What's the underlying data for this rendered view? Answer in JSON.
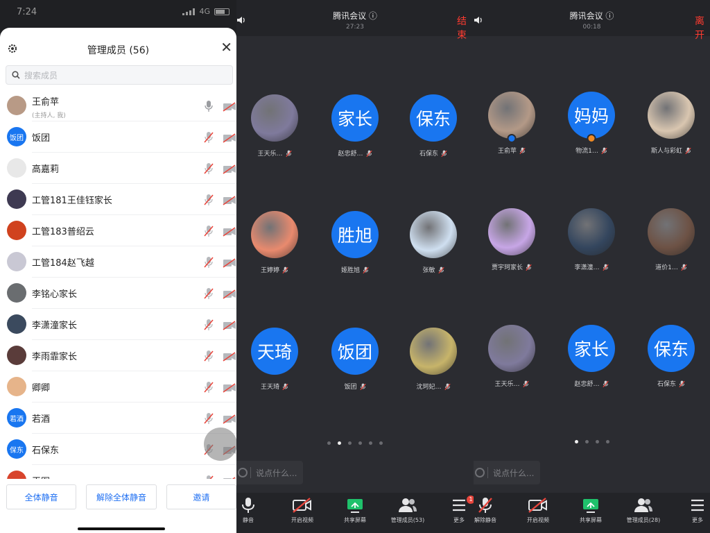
{
  "left": {
    "status": {
      "time": "7:24",
      "network": "4G"
    },
    "title": "管理成员 (56)",
    "search_placeholder": "搜索成员",
    "members": [
      {
        "name": "王俞苹",
        "sub": "(主持人, 我)",
        "avatar": "photo",
        "color": "#b89a86"
      },
      {
        "name": "饭团",
        "avatar_text": "饭团",
        "color": "#1976f0"
      },
      {
        "name": "高嘉莉",
        "avatar": "photo",
        "color": "#e8e8e8"
      },
      {
        "name": "工管181王佳钰家长",
        "avatar": "photo",
        "color": "#3e3a52"
      },
      {
        "name": "工管183普绍云",
        "avatar": "photo",
        "color": "#d0421e"
      },
      {
        "name": "工管184赵飞越",
        "avatar": "photo",
        "color": "#c9c8d4"
      },
      {
        "name": "李铭心家长",
        "avatar": "photo",
        "color": "#6a6d70"
      },
      {
        "name": "李潇潼家长",
        "avatar": "photo",
        "color": "#3b4a5e"
      },
      {
        "name": "李雨霏家长",
        "avatar": "photo",
        "color": "#5a3c3a"
      },
      {
        "name": "卿卿",
        "avatar": "photo",
        "color": "#e6b48a"
      },
      {
        "name": "若酒",
        "avatar_text": "若酒",
        "color": "#1976f0"
      },
      {
        "name": "石保东",
        "avatar_text": "保东",
        "color": "#1976f0"
      },
      {
        "name": "王图",
        "avatar": "photo",
        "color": "#d8442c"
      }
    ],
    "buttons": {
      "mute_all": "全体静音",
      "unmute_all": "解除全体静音",
      "invite": "邀请"
    }
  },
  "mid": {
    "title": "腾讯会议",
    "timer": "27:23",
    "end": "结束",
    "participants": [
      {
        "name": "王天乐…",
        "avatar": "photo",
        "color": "#7f7a9c"
      },
      {
        "name": "赵忠舒…",
        "avatar_text": "家长"
      },
      {
        "name": "石保东",
        "avatar_text": "保东"
      },
      {
        "name": "王婷婷",
        "avatar": "photo",
        "color": "#e98a6e"
      },
      {
        "name": "姬胜旭",
        "avatar_text": "胜旭"
      },
      {
        "name": "张敏",
        "avatar": "photo",
        "color": "#cfdff0"
      },
      {
        "name": "王天琦",
        "avatar_text": "天琦"
      },
      {
        "name": "饭团",
        "avatar_text": "饭团"
      },
      {
        "name": "沈珂妃…",
        "avatar": "photo",
        "color": "#c7b46a"
      }
    ],
    "chat_placeholder": "说点什么...",
    "toolbar": [
      {
        "label": "静音",
        "icon": "mic"
      },
      {
        "label": "开启视频",
        "icon": "video-off"
      },
      {
        "label": "共享屏幕",
        "icon": "share"
      },
      {
        "label": "管理成员(53)",
        "icon": "members"
      },
      {
        "label": "更多",
        "icon": "more",
        "badge": "1"
      }
    ]
  },
  "right": {
    "title": "腾讯会议",
    "timer": "00:18",
    "end": "离开",
    "participants": [
      {
        "name": "王俞苹",
        "avatar": "photo",
        "color": "#b39987",
        "badge": "#1976f0"
      },
      {
        "name": "物流1…",
        "avatar_text": "妈妈",
        "badge": "#f08a24"
      },
      {
        "name": "斯人与彩虹",
        "avatar": "photo",
        "color": "#d9c6b0"
      },
      {
        "name": "贾宇珂家长",
        "avatar": "photo",
        "color": "#c7a6e6"
      },
      {
        "name": "李潇潼…",
        "avatar": "photo",
        "color": "#34465e"
      },
      {
        "name": "道价1…",
        "avatar": "photo",
        "color": "#6d5245"
      },
      {
        "name": "王天乐…",
        "avatar": "photo",
        "color": "#7f7a9c"
      },
      {
        "name": "赵忠舒…",
        "avatar_text": "家长"
      },
      {
        "name": "石保东",
        "avatar_text": "保东"
      }
    ],
    "chat_placeholder": "说点什么...",
    "toolbar": [
      {
        "label": "解除静音",
        "icon": "mic-off"
      },
      {
        "label": "开启视频",
        "icon": "video-off"
      },
      {
        "label": "共享屏幕",
        "icon": "share"
      },
      {
        "label": "管理成员(28)",
        "icon": "members"
      },
      {
        "label": "更多",
        "icon": "more"
      }
    ]
  }
}
